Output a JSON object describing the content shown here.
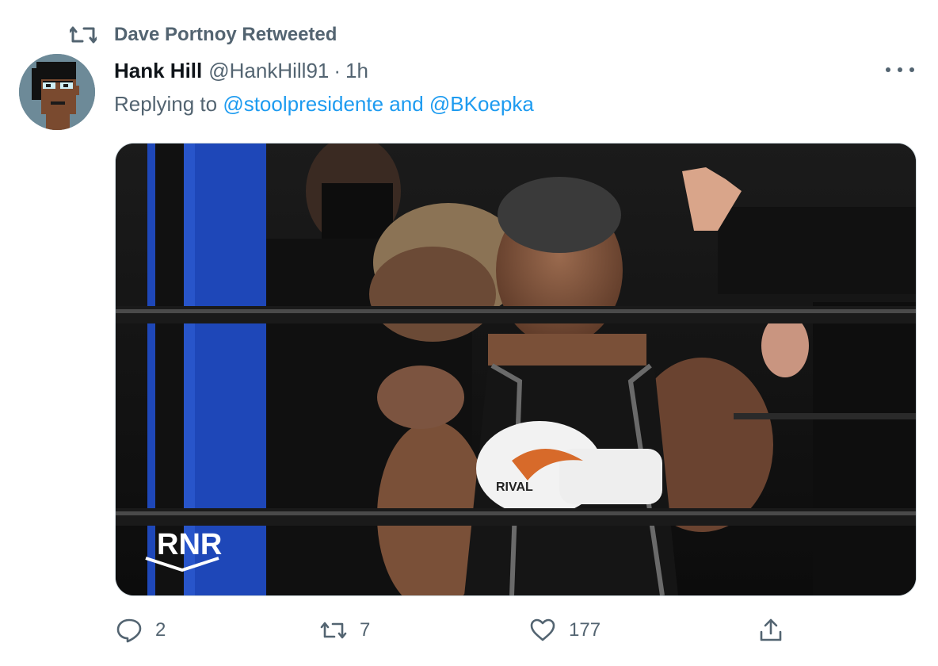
{
  "retweet_notice": {
    "text": "Dave Portnoy Retweeted",
    "icon": "retweet-icon"
  },
  "tweet": {
    "author_name": "Hank Hill",
    "handle": "@HankHill91",
    "separator": "·",
    "time": "1h",
    "replying_prefix": "Replying to",
    "reply_to_1": "@stoolpresidente",
    "reply_joiner": "and",
    "reply_to_2": "@BKoepka",
    "media": {
      "watermark": "RNR",
      "glove_brand": "RIVAL"
    }
  },
  "actions": {
    "reply_count": "2",
    "retweet_count": "7",
    "like_count": "177"
  },
  "colors": {
    "link": "#1d9bf0",
    "secondary_text": "#536471",
    "primary_text": "#0f1419"
  }
}
